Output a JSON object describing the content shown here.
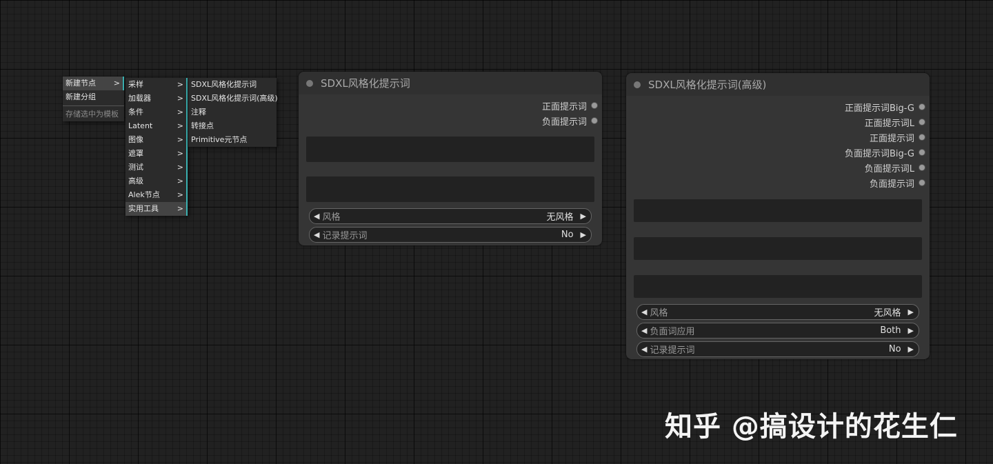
{
  "root_menu": {
    "items": [
      {
        "label": "新建节点",
        "arrow": ">"
      },
      {
        "label": "新建分组"
      },
      {
        "label": "存储选中为模板"
      }
    ]
  },
  "node_menu": {
    "items": [
      {
        "label": "采样",
        "arrow": ">"
      },
      {
        "label": "加载器",
        "arrow": ">"
      },
      {
        "label": "条件",
        "arrow": ">"
      },
      {
        "label": "Latent",
        "arrow": ">"
      },
      {
        "label": "图像",
        "arrow": ">"
      },
      {
        "label": "遮罩",
        "arrow": ">"
      },
      {
        "label": "测试",
        "arrow": ">"
      },
      {
        "label": "高级",
        "arrow": ">"
      },
      {
        "label": "Alek节点",
        "arrow": ">"
      },
      {
        "label": "实用工具",
        "arrow": ">"
      }
    ]
  },
  "utils_menu": {
    "items": [
      {
        "label": "SDXL风格化提示词"
      },
      {
        "label": "SDXL风格化提示词(高级)"
      },
      {
        "label": "注释"
      },
      {
        "label": "转接点"
      },
      {
        "label": "Primitive元节点"
      }
    ]
  },
  "node1": {
    "title": "SDXL风格化提示词",
    "outputs": [
      "正面提示词",
      "负面提示词"
    ],
    "widgets": [
      {
        "label": "风格",
        "value": "无风格"
      },
      {
        "label": "记录提示词",
        "value": "No"
      }
    ]
  },
  "node2": {
    "title": "SDXL风格化提示词(高级)",
    "outputs": [
      "正面提示词Big-G",
      "正面提示词L",
      "正面提示词",
      "负面提示词Big-G",
      "负面提示词L",
      "负面提示词"
    ],
    "widgets": [
      {
        "label": "风格",
        "value": "无风格"
      },
      {
        "label": "负面词应用",
        "value": "Both"
      },
      {
        "label": "记录提示词",
        "value": "No"
      }
    ]
  },
  "widget_arrows": {
    "left": "◀",
    "right": "▶"
  },
  "watermark": "知乎 @搞设计的花生仁"
}
